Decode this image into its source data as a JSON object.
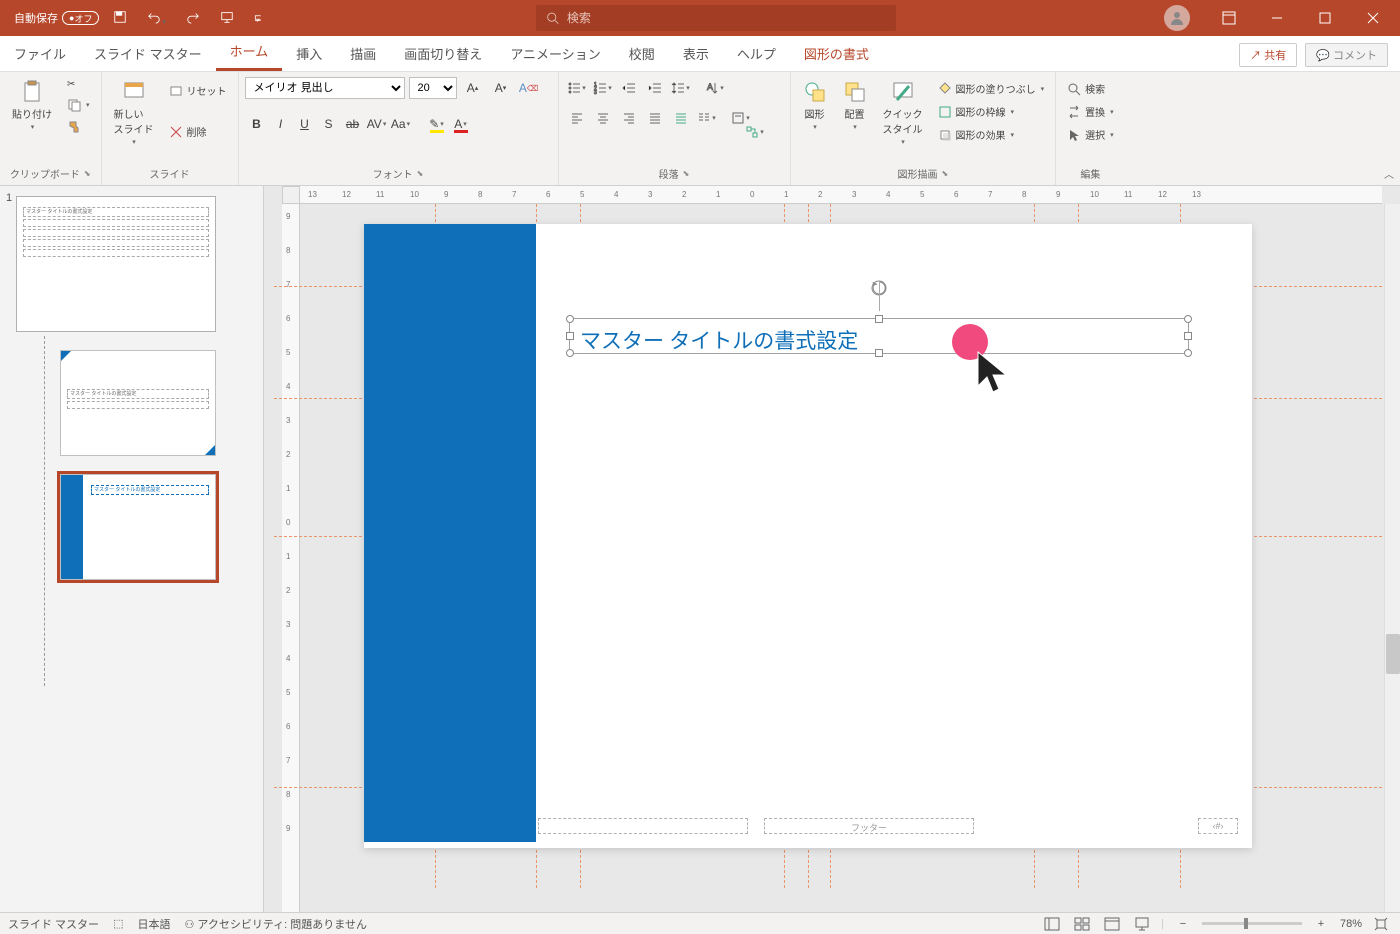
{
  "titlebar": {
    "autosave_label": "自動保存",
    "autosave_state": "オフ"
  },
  "search": {
    "placeholder": "検索"
  },
  "tabs": {
    "file": "ファイル",
    "slidemaster": "スライド マスター",
    "home": "ホーム",
    "insert": "挿入",
    "draw": "描画",
    "transition": "画面切り替え",
    "animation": "アニメーション",
    "review": "校閲",
    "view": "表示",
    "help": "ヘルプ",
    "shapeformat": "図形の書式"
  },
  "share": {
    "label": "共有",
    "comment": "コメント"
  },
  "ribbon": {
    "clipboard": {
      "paste": "貼り付け",
      "label": "クリップボード"
    },
    "slides": {
      "newslide": "新しい\nスライド",
      "reset": "リセット",
      "delete": "削除",
      "label": "スライド"
    },
    "font": {
      "name": "メイリオ 見出し",
      "size": "20",
      "label": "フォント"
    },
    "paragraph": {
      "label": "段落"
    },
    "drawing": {
      "shapes": "図形",
      "arrange": "配置",
      "quickstyle": "クイック\nスタイル",
      "fill": "図形の塗りつぶし",
      "outline": "図形の枠線",
      "effects": "図形の効果",
      "label": "図形描画"
    },
    "editing": {
      "find": "検索",
      "replace": "置換",
      "select": "選択",
      "label": "編集"
    }
  },
  "sidebar": {
    "masternum": "1",
    "thumb_title": "マスター タイトルの書式設定"
  },
  "slide": {
    "title": "マスター タイトルの書式設定",
    "footer": "フッター",
    "pagenum": "‹#›"
  },
  "ruler_h": [
    "13",
    "12",
    "11",
    "10",
    "9",
    "8",
    "7",
    "6",
    "5",
    "4",
    "3",
    "2",
    "1",
    "0",
    "1",
    "2",
    "3",
    "4",
    "5",
    "6",
    "7",
    "8",
    "9",
    "10",
    "11",
    "12",
    "13"
  ],
  "ruler_v": [
    "9",
    "8",
    "7",
    "6",
    "5",
    "4",
    "3",
    "2",
    "1",
    "0",
    "1",
    "2",
    "3",
    "4",
    "5",
    "6",
    "7",
    "8",
    "9"
  ],
  "statusbar": {
    "mode": "スライド マスター",
    "lang": "日本語",
    "access": "アクセシビリティ: 問題ありません",
    "zoom": "78%"
  }
}
